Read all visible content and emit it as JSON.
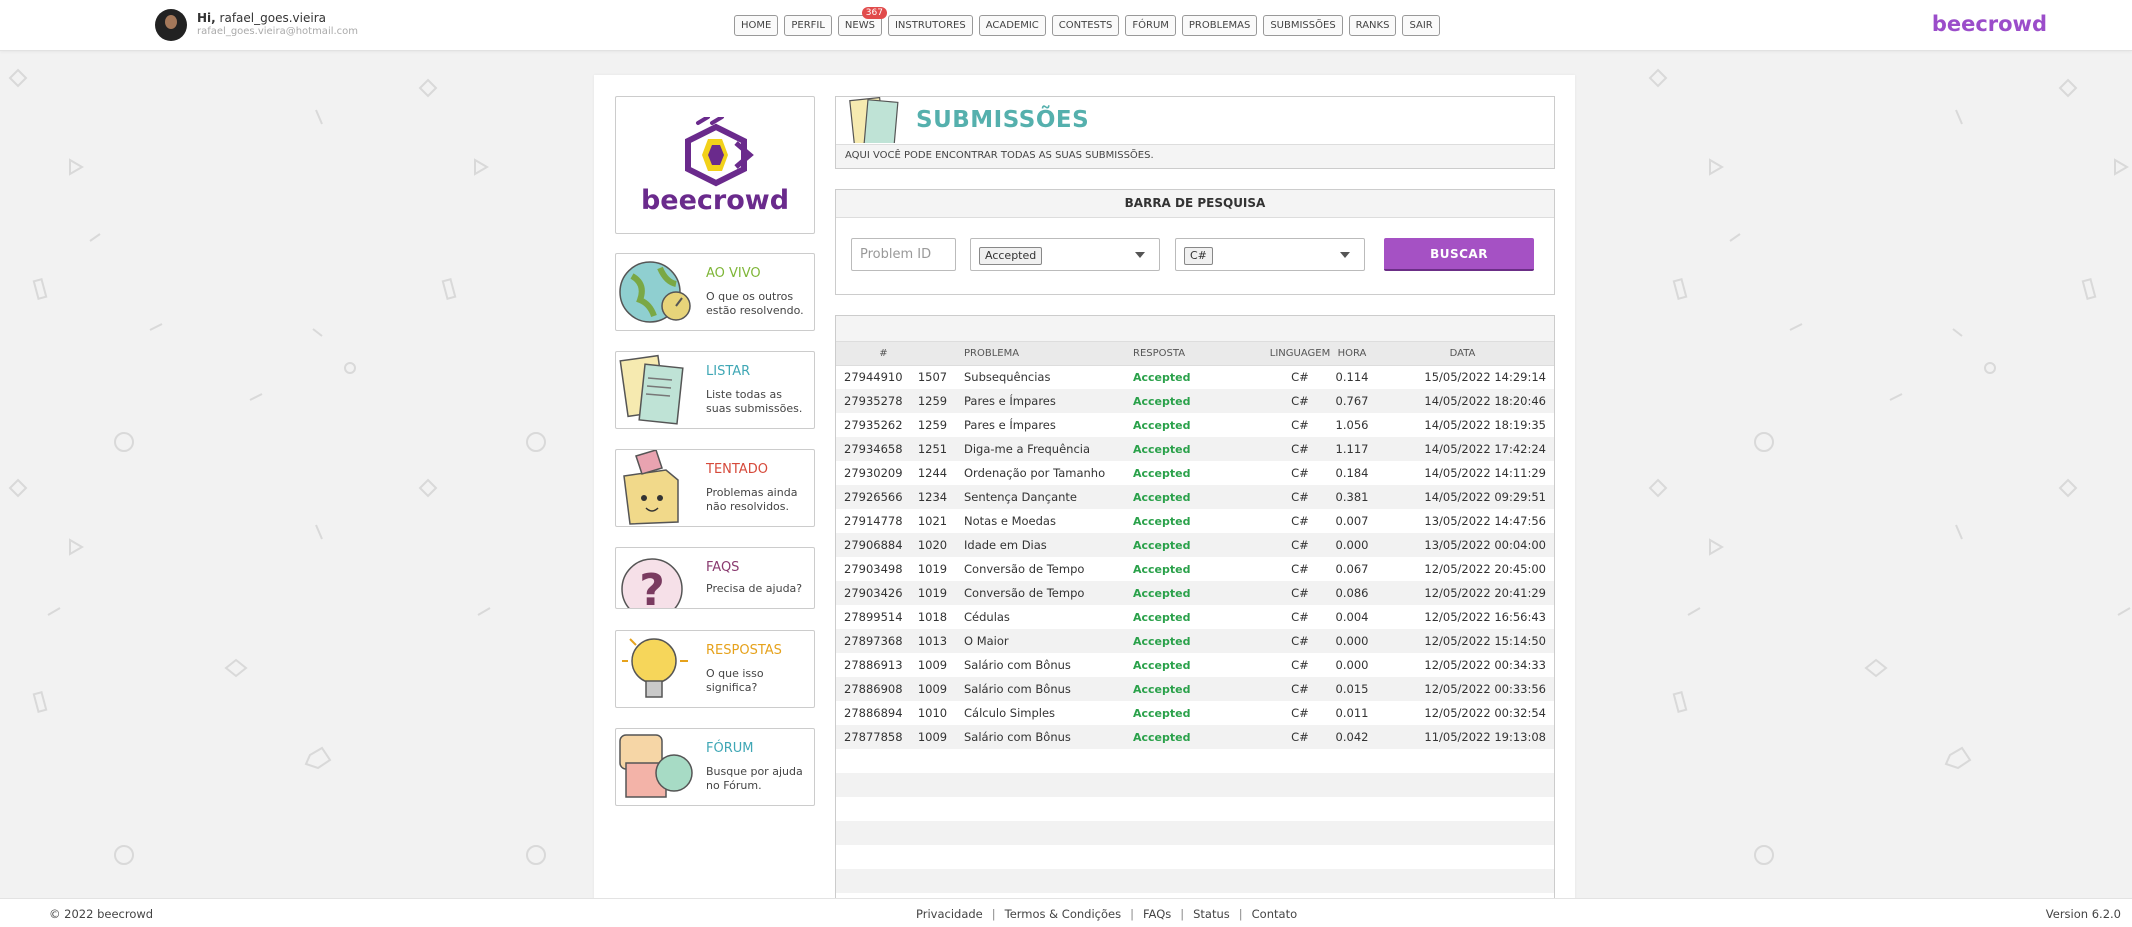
{
  "user": {
    "greeting": "Hi,",
    "name": "rafael_goes.vieira",
    "email": "rafael_goes.vieira@hotmail.com"
  },
  "nav": {
    "items": [
      "HOME",
      "PERFIL",
      "NEWS",
      "INSTRUTORES",
      "ACADEMIC",
      "CONTESTS",
      "FÓRUM",
      "PROBLEMAS",
      "SUBMISSÕES",
      "RANKS",
      "SAIR"
    ],
    "news_badge": "367"
  },
  "brand": "beecrowd",
  "logo_text": "beecrowd",
  "sidebar": [
    {
      "title": "AO VIVO",
      "desc": "O que os outros estão resolvendo.",
      "color": "#7fb638"
    },
    {
      "title": "LISTAR",
      "desc": "Liste todas as suas submissões.",
      "color": "#3fa7b5"
    },
    {
      "title": "TENTADO",
      "desc": "Problemas ainda não resolvidos.",
      "color": "#d64a3b"
    },
    {
      "title": "FAQS",
      "desc": "Precisa de ajuda?",
      "color": "#8a3b70"
    },
    {
      "title": "RESPOSTAS",
      "desc": "O que isso significa?",
      "color": "#e6a21c"
    },
    {
      "title": "FÓRUM",
      "desc": "Busque por ajuda no Fórum.",
      "color": "#3fa7b5"
    }
  ],
  "header": {
    "title": "SUBMISSÕES",
    "subtitle": "AQUI VOCÊ PODE ENCONTRAR TODAS AS SUAS SUBMISSÕES."
  },
  "search": {
    "title": "BARRA DE PESQUISA",
    "problem_placeholder": "Problem ID",
    "answer_selected": "Accepted",
    "language_selected": "C#",
    "button": "BUSCAR"
  },
  "table": {
    "columns": [
      "#",
      "PROBLEMA",
      "RESPOSTA",
      "LINGUAGEM",
      "HORA",
      "DATA"
    ],
    "rows": [
      {
        "id": "27944910",
        "num": "1507",
        "problem": "Subsequências",
        "answer": "Accepted",
        "lang": "C#",
        "time": "0.114",
        "date": "15/05/2022 14:29:14"
      },
      {
        "id": "27935278",
        "num": "1259",
        "problem": "Pares e Ímpares",
        "answer": "Accepted",
        "lang": "C#",
        "time": "0.767",
        "date": "14/05/2022 18:20:46"
      },
      {
        "id": "27935262",
        "num": "1259",
        "problem": "Pares e Ímpares",
        "answer": "Accepted",
        "lang": "C#",
        "time": "1.056",
        "date": "14/05/2022 18:19:35"
      },
      {
        "id": "27934658",
        "num": "1251",
        "problem": "Diga-me a Frequência",
        "answer": "Accepted",
        "lang": "C#",
        "time": "1.117",
        "date": "14/05/2022 17:42:24"
      },
      {
        "id": "27930209",
        "num": "1244",
        "problem": "Ordenação por Tamanho",
        "answer": "Accepted",
        "lang": "C#",
        "time": "0.184",
        "date": "14/05/2022 14:11:29"
      },
      {
        "id": "27926566",
        "num": "1234",
        "problem": "Sentença Dançante",
        "answer": "Accepted",
        "lang": "C#",
        "time": "0.381",
        "date": "14/05/2022 09:29:51"
      },
      {
        "id": "27914778",
        "num": "1021",
        "problem": "Notas e Moedas",
        "answer": "Accepted",
        "lang": "C#",
        "time": "0.007",
        "date": "13/05/2022 14:47:56"
      },
      {
        "id": "27906884",
        "num": "1020",
        "problem": "Idade em Dias",
        "answer": "Accepted",
        "lang": "C#",
        "time": "0.000",
        "date": "13/05/2022 00:04:00"
      },
      {
        "id": "27903498",
        "num": "1019",
        "problem": "Conversão de Tempo",
        "answer": "Accepted",
        "lang": "C#",
        "time": "0.067",
        "date": "12/05/2022 20:45:00"
      },
      {
        "id": "27903426",
        "num": "1019",
        "problem": "Conversão de Tempo",
        "answer": "Accepted",
        "lang": "C#",
        "time": "0.086",
        "date": "12/05/2022 20:41:29"
      },
      {
        "id": "27899514",
        "num": "1018",
        "problem": "Cédulas",
        "answer": "Accepted",
        "lang": "C#",
        "time": "0.004",
        "date": "12/05/2022 16:56:43"
      },
      {
        "id": "27897368",
        "num": "1013",
        "problem": "O Maior",
        "answer": "Accepted",
        "lang": "C#",
        "time": "0.000",
        "date": "12/05/2022 15:14:50"
      },
      {
        "id": "27886913",
        "num": "1009",
        "problem": "Salário com Bônus",
        "answer": "Accepted",
        "lang": "C#",
        "time": "0.000",
        "date": "12/05/2022 00:34:33"
      },
      {
        "id": "27886908",
        "num": "1009",
        "problem": "Salário com Bônus",
        "answer": "Accepted",
        "lang": "C#",
        "time": "0.015",
        "date": "12/05/2022 00:33:56"
      },
      {
        "id": "27886894",
        "num": "1010",
        "problem": "Cálculo Simples",
        "answer": "Accepted",
        "lang": "C#",
        "time": "0.011",
        "date": "12/05/2022 00:32:54"
      },
      {
        "id": "27877858",
        "num": "1009",
        "problem": "Salário com Bônus",
        "answer": "Accepted",
        "lang": "C#",
        "time": "0.042",
        "date": "11/05/2022 19:13:08"
      }
    ]
  },
  "footer": {
    "copyright": "© 2022 beecrowd",
    "links": [
      "Privacidade",
      "Termos & Condições",
      "FAQs",
      "Status",
      "Contato"
    ],
    "version": "Version 6.2.0"
  },
  "colors": {
    "brand": "#9b4dca",
    "accepted": "#2aa14a",
    "button": "#a551c4",
    "title": "#55b0ad"
  }
}
